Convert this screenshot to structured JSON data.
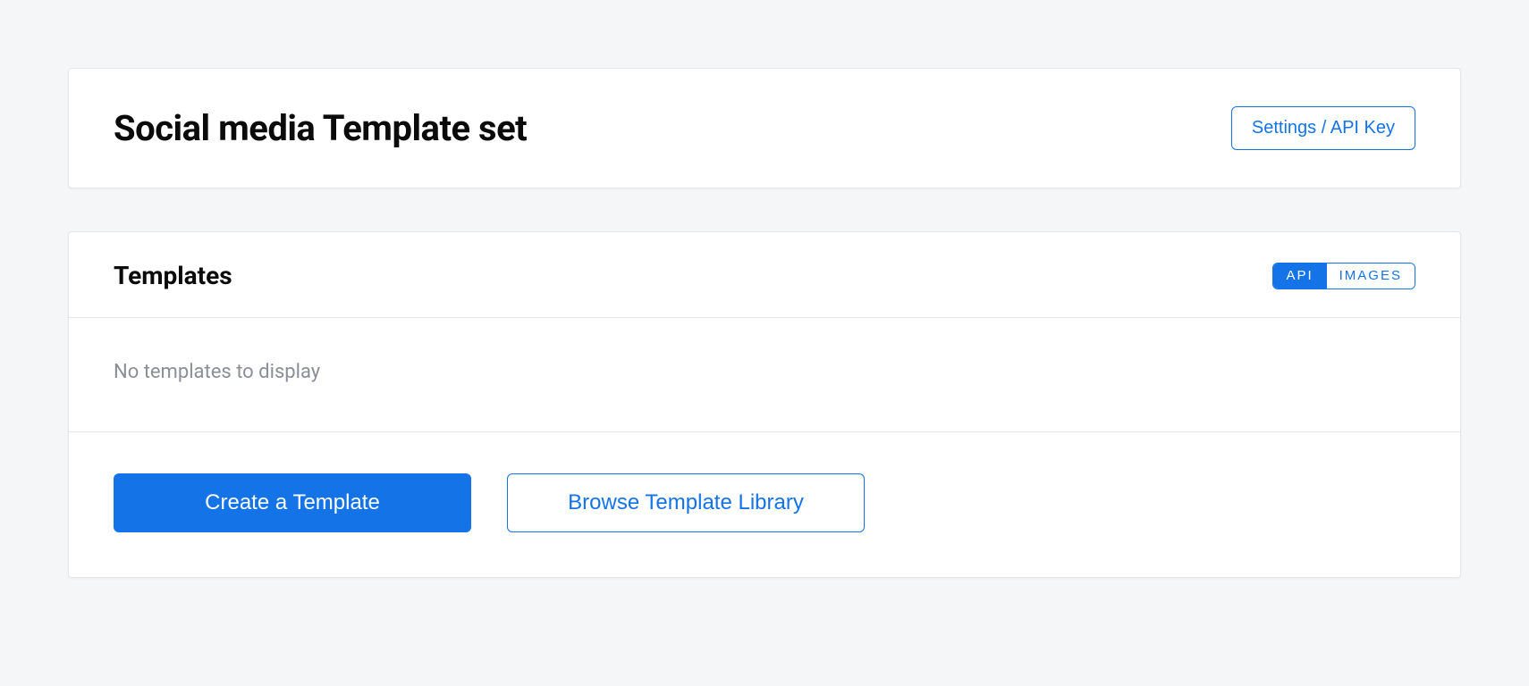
{
  "header": {
    "title": "Social media Template set",
    "settings_button": "Settings / API Key"
  },
  "templates": {
    "section_title": "Templates",
    "toggle": {
      "api": "API",
      "images": "IMAGES",
      "active": "api"
    },
    "empty_message": "No templates to display",
    "actions": {
      "create": "Create a Template",
      "browse": "Browse Template Library"
    }
  }
}
